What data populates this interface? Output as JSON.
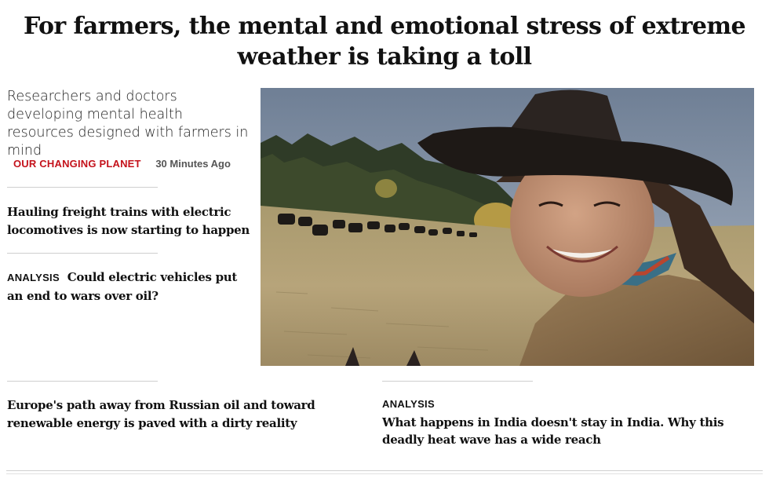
{
  "lead": {
    "headline": "For farmers, the mental and emotional stress of extreme weather is taking a toll",
    "summary": "Researchers and doctors developing mental health resources designed with farmers in mind",
    "section": "OUR CHANGING PLANET",
    "timestamp": "30 Minutes Ago",
    "image": "photo of a smiling woman in a cowboy hat and bandana on horseback in a pasture with a herd of cattle"
  },
  "stories": [
    {
      "tag": "",
      "title": "Hauling freight trains with electric locomotives is now starting to happen"
    },
    {
      "tag": "ANALYSIS",
      "title": "Could electric vehicles put an end to wars over oil?"
    },
    {
      "tag": "",
      "title": "Europe's path away from Russian oil and toward renewable energy is paved with a dirty reality"
    },
    {
      "tag": "ANALYSIS",
      "title": "What happens in India doesn't stay in India. Why this deadly heat wave has a wide reach"
    }
  ],
  "colors": {
    "accent": "#c4121b",
    "text": "#111111",
    "rule": "#cfcfcf"
  }
}
